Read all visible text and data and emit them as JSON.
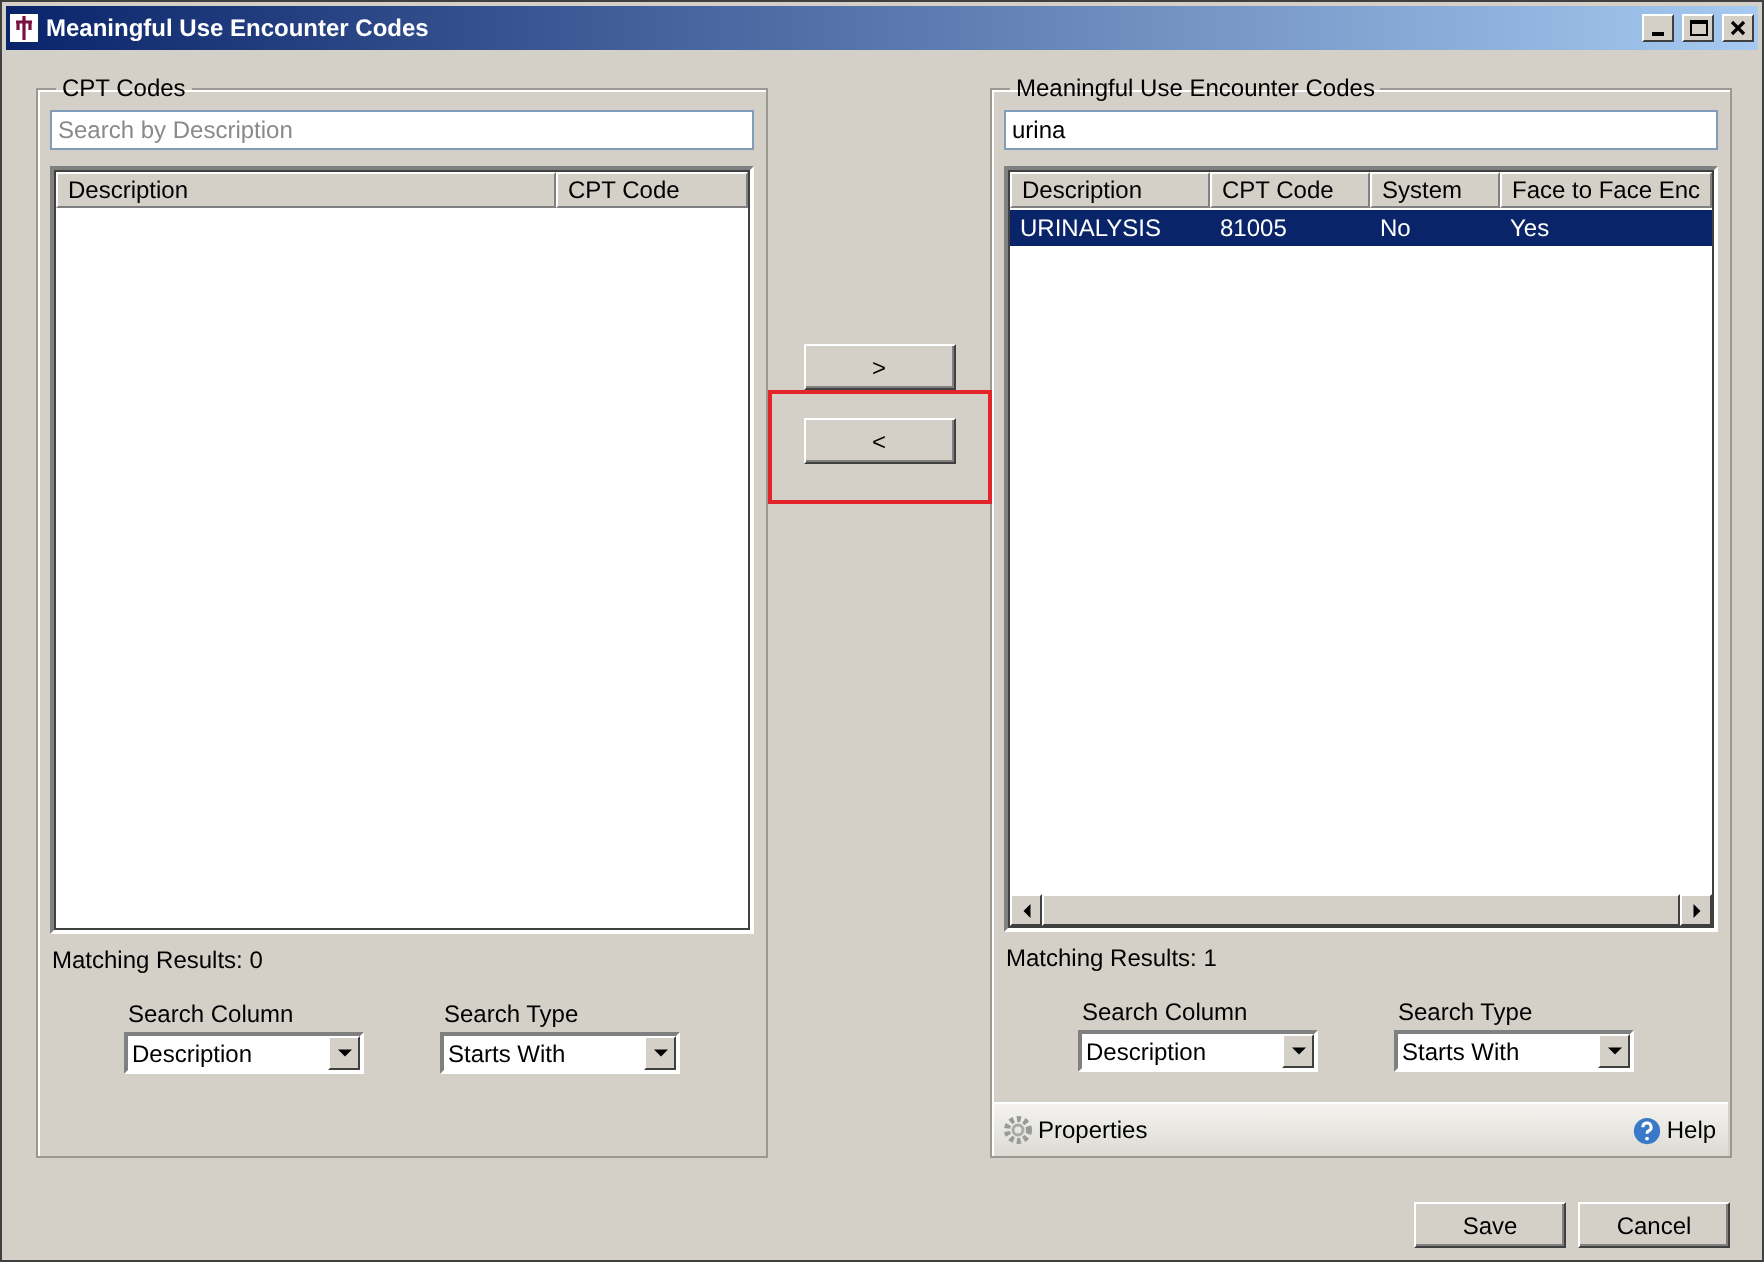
{
  "window": {
    "title": "Meaningful Use Encounter Codes"
  },
  "left_panel": {
    "title": "CPT Codes",
    "search": {
      "placeholder": "Search by Description"
    },
    "table": {
      "columns": [
        "Description",
        "CPT Code"
      ]
    },
    "matching_results": "Matching Results: 0",
    "search_column": {
      "label": "Search Column",
      "value": "Description"
    },
    "search_type": {
      "label": "Search Type",
      "value": "Starts With"
    }
  },
  "transfer_buttons": [
    {
      "label": ">",
      "highlighted": false
    },
    {
      "label": "<",
      "highlighted": true
    }
  ],
  "right_panel": {
    "title": "Meaningful Use Encounter Codes",
    "search": {
      "value": "urina"
    },
    "table": {
      "columns": [
        "Description",
        "CPT Code",
        "System",
        "Face to Face Enc"
      ],
      "rows": [
        {
          "cells": [
            "URINALYSIS",
            "81005",
            "No",
            "Yes"
          ],
          "selected": true
        }
      ]
    },
    "matching_results": "Matching Results: 1",
    "search_column": {
      "label": "Search Column",
      "value": "Description"
    },
    "search_type": {
      "label": "Search Type",
      "value": "Starts With"
    },
    "footer": {
      "properties": "Properties",
      "help": "Help"
    }
  },
  "buttons": [
    "Save",
    "Cancel"
  ]
}
